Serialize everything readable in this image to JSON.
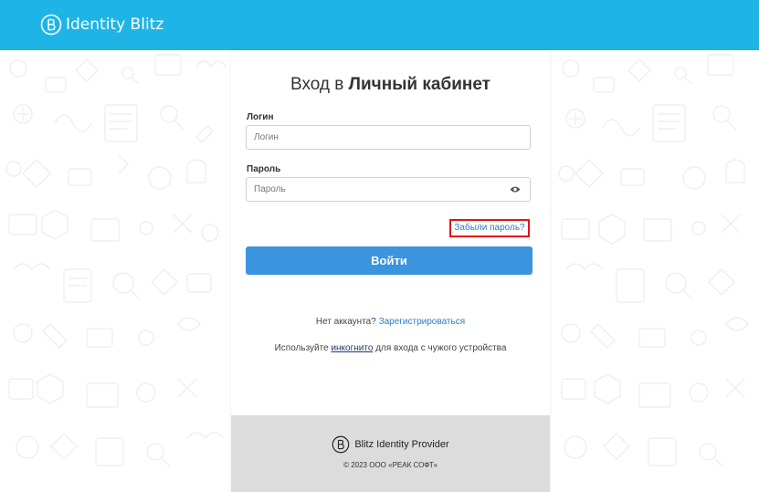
{
  "header": {
    "brand_name": "Identity Blitz",
    "brand_logo": "blitz-b-logo-icon",
    "background_color": "#1eb4e6"
  },
  "login": {
    "title_prefix": "Вход в",
    "title_bold": "Личный кабинет",
    "username": {
      "label": "Логин",
      "placeholder": "Логин",
      "value": ""
    },
    "password": {
      "label": "Пароль",
      "placeholder": "Пароль",
      "value": "",
      "toggle_icon": "eye-icon"
    },
    "forgot_link": "Забыли пароль?",
    "submit_label": "Войти",
    "submit_color": "#3b94de",
    "no_account_text": "Нет аккаунта?",
    "register_link": "Зарегистрироваться",
    "incognito_prefix": "Используйте",
    "incognito_link": "инкогнито",
    "incognito_suffix": "для входа с чужого устройства"
  },
  "footer": {
    "product_name": "Blitz Identity Provider",
    "copyright": "© 2023 ООО «РЕАК СОФТ»"
  },
  "colors": {
    "link": "#2a7cc7",
    "highlight_box": "#e3141b",
    "footer_bg": "#dcdcdc"
  }
}
